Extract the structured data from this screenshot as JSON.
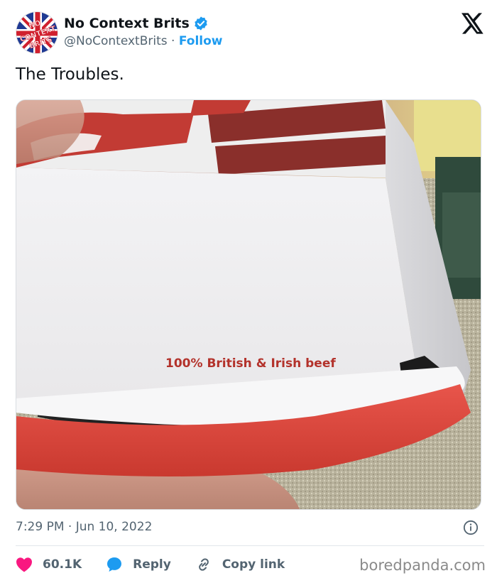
{
  "header": {
    "display_name": "No Context Brits",
    "handle": "@NoContextBrits",
    "separator": " · ",
    "follow_label": "Follow",
    "avatar_text": [
      "NO",
      "CONTEXT",
      "BRITS"
    ]
  },
  "tweet": {
    "text": "The Troubles.",
    "timestamp": "7:29 PM · Jun 10, 2022"
  },
  "media": {
    "printed_text": "100% British & Irish beef"
  },
  "actions": {
    "like_count": "60.1K",
    "reply_label": "Reply",
    "copy_label": "Copy link"
  },
  "watermark": "boredpanda.com",
  "colors": {
    "link_blue": "#1d9bf0",
    "like_red": "#f91880",
    "text_gray": "#536471",
    "box_red": "#e0483e"
  },
  "icons": [
    "verified-badge-icon",
    "x-logo-icon",
    "info-icon",
    "heart-icon",
    "reply-bubble-icon",
    "link-icon"
  ]
}
